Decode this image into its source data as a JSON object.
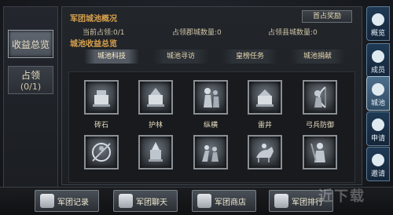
{
  "left_tabs": [
    {
      "label": "收益总览",
      "sub": ""
    },
    {
      "label": "占领",
      "sub": "(0/1)"
    }
  ],
  "overview": {
    "title": "军团城池概况",
    "current_label": "当前占领:0/1",
    "county_count_label": "占领郡城数量:0",
    "town_count_label": "占领县城数量:0",
    "first_reward_button": "首占奖励"
  },
  "income": {
    "title": "城池收益总览",
    "tabs": [
      "城池科技",
      "城池寻访",
      "皇榜任务",
      "城池捐献"
    ]
  },
  "tech_items": [
    {
      "label": "砖石",
      "icon": "brick-stone-icon"
    },
    {
      "label": "护林",
      "icon": "forest-guard-icon"
    },
    {
      "label": "纵横",
      "icon": "strategist-icon"
    },
    {
      "label": "雷井",
      "icon": "thunder-well-icon"
    },
    {
      "label": "弓兵防御",
      "icon": "archer-defense-icon"
    },
    {
      "label": "",
      "icon": "cavalry-icon"
    },
    {
      "label": "",
      "icon": "war-drum-icon"
    },
    {
      "label": "",
      "icon": "infantry-icon"
    },
    {
      "label": "",
      "icon": "horse-rider-icon"
    },
    {
      "label": "",
      "icon": "soldier-icon"
    }
  ],
  "right_tabs": [
    {
      "label": "概览",
      "icon": "overview-icon"
    },
    {
      "label": "成员",
      "icon": "members-icon"
    },
    {
      "label": "城池",
      "icon": "city-icon"
    },
    {
      "label": "申请",
      "icon": "apply-icon"
    },
    {
      "label": "邀请",
      "icon": "invite-icon"
    }
  ],
  "bottom_buttons": [
    {
      "label": "军团记录",
      "icon": "flag-icon"
    },
    {
      "label": "军团聊天",
      "icon": "chat-icon"
    },
    {
      "label": "军团商店",
      "icon": "shop-icon"
    },
    {
      "label": "军团排行",
      "icon": "ranking-icon"
    }
  ],
  "watermark": "近下载"
}
